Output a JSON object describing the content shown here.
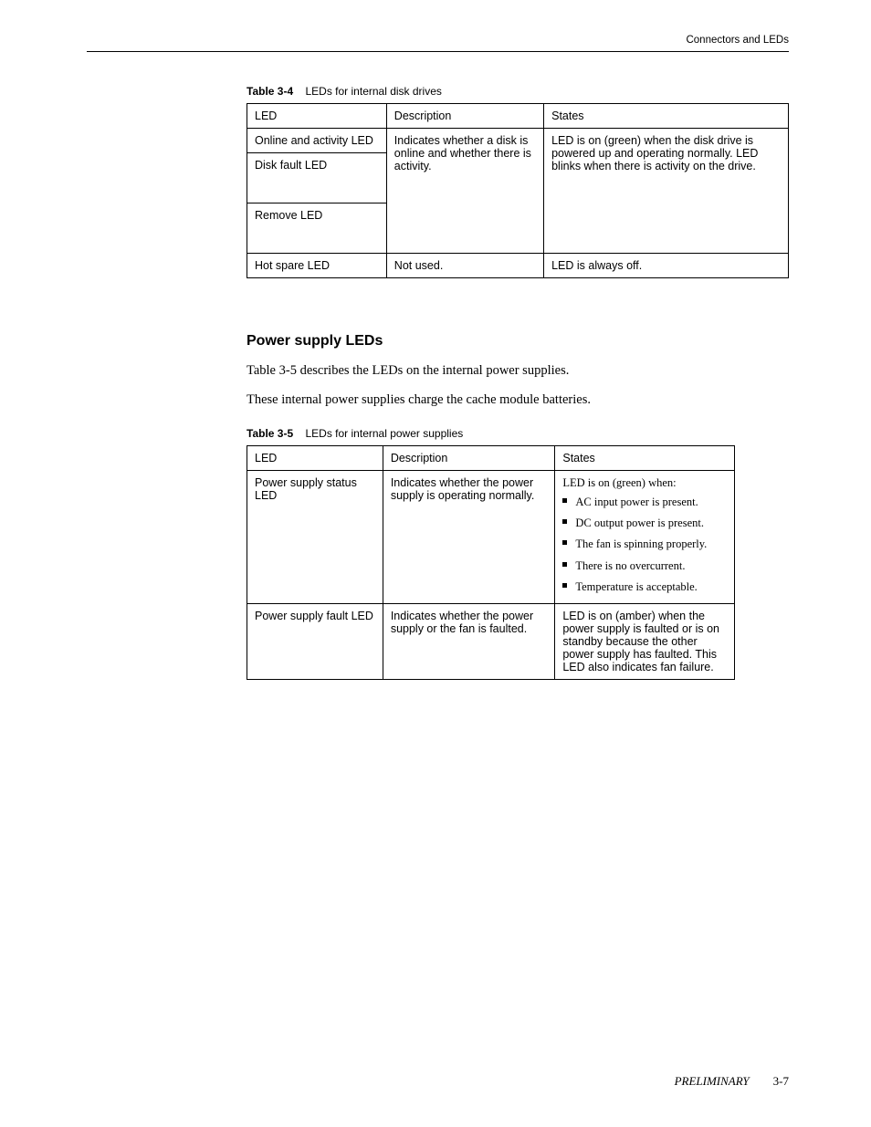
{
  "header": {
    "right": "Connectors and LEDs"
  },
  "table4": {
    "caption_label": "Table 3-4",
    "caption_text": "LEDs for internal disk drives",
    "headers": [
      "LED",
      "Description",
      "States"
    ],
    "rows": [
      {
        "led": "Online and activity LED",
        "desc": "Indicates whether a disk is online and whether there is activity.",
        "states": "LED is on (green) when the disk drive is powered up and operating normally. LED blinks when there is activity on the drive."
      },
      {
        "led": "Disk fault LED",
        "desc": "",
        "states": ""
      },
      {
        "led": "Remove LED",
        "desc": "",
        "states": ""
      },
      {
        "led": "Hot spare LED",
        "desc": "Not used.",
        "states": "LED is always off."
      }
    ]
  },
  "section": {
    "title": "Power supply LEDs",
    "para1": "Table 3-5 describes the LEDs on the internal power supplies.",
    "para2": "These internal power supplies charge the cache module batteries."
  },
  "table5": {
    "caption_label": "Table 3-5",
    "caption_text": "LEDs for internal power supplies",
    "headers": [
      "LED",
      "Description",
      "States"
    ],
    "rows": [
      {
        "led": "Power supply status LED",
        "desc": "Indicates whether the power supply is operating normally.",
        "states_lead": "LED is on (green) when:",
        "states_list": [
          "AC input power is present.",
          "DC output power is present.",
          "The fan is spinning properly.",
          "There is no overcurrent.",
          "Temperature is acceptable."
        ]
      },
      {
        "led": "Power supply fault LED",
        "desc": "Indicates whether the power supply or the fan is faulted.",
        "states": "LED is on (amber) when the power supply is faulted or is on standby because the other power supply has faulted. This LED also indicates fan failure."
      }
    ]
  },
  "footer": {
    "label": "PRELIMINARY",
    "page": "3-7"
  }
}
